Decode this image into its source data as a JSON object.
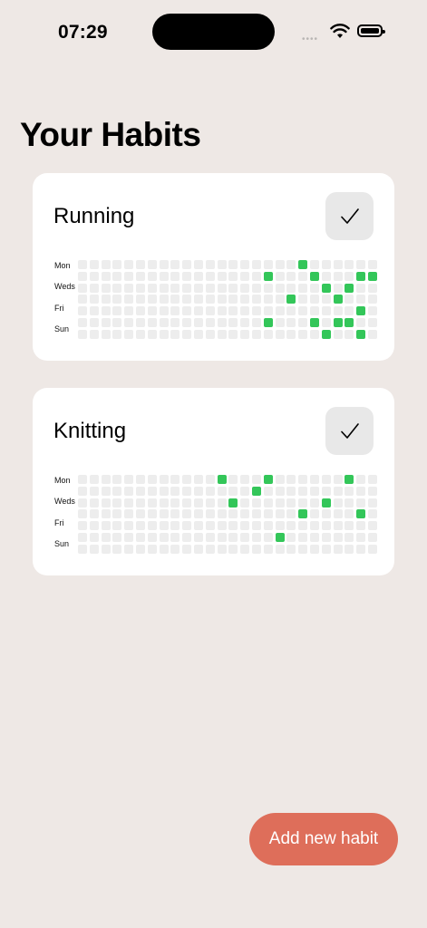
{
  "status_bar": {
    "time": "07:29",
    "signal_dots": "••••"
  },
  "page": {
    "title": "Your Habits"
  },
  "habits": [
    {
      "name": "Running",
      "check_symbol": "✓",
      "day_labels": [
        "Mon",
        "Weds",
        "Fri",
        "Sun"
      ],
      "active_cells": [
        [
          0,
          19
        ],
        [
          1,
          16
        ],
        [
          1,
          20
        ],
        [
          1,
          24
        ],
        [
          1,
          25
        ],
        [
          2,
          21
        ],
        [
          2,
          23
        ],
        [
          3,
          18
        ],
        [
          3,
          22
        ],
        [
          4,
          24
        ],
        [
          5,
          16
        ],
        [
          5,
          20
        ],
        [
          5,
          22
        ],
        [
          5,
          23
        ],
        [
          6,
          21
        ],
        [
          6,
          24
        ]
      ]
    },
    {
      "name": "Knitting",
      "check_symbol": "✓",
      "day_labels": [
        "Mon",
        "Weds",
        "Fri",
        "Sun"
      ],
      "active_cells": [
        [
          0,
          12
        ],
        [
          0,
          16
        ],
        [
          0,
          23
        ],
        [
          1,
          15
        ],
        [
          2,
          13
        ],
        [
          2,
          21
        ],
        [
          3,
          19
        ],
        [
          3,
          24
        ],
        [
          5,
          17
        ]
      ]
    }
  ],
  "actions": {
    "add_label": "Add new habit"
  },
  "colors": {
    "background": "#EEE8E5",
    "card": "#FFFFFF",
    "active_cell": "#33C659",
    "empty_cell": "#EDEDED",
    "add_button": "#DE6E5A"
  }
}
